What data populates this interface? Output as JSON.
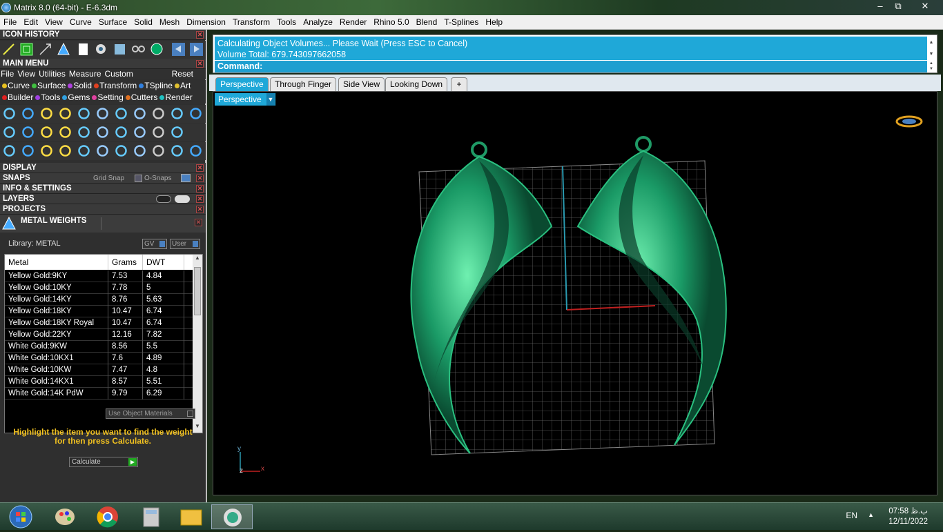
{
  "window": {
    "title": "Matrix 8.0 (64-bit) - E-6.3dm",
    "min": "‒",
    "max": "⧉",
    "close": "✕"
  },
  "menubar": [
    "File",
    "Edit",
    "View",
    "Curve",
    "Surface",
    "Solid",
    "Mesh",
    "Dimension",
    "Transform",
    "Tools",
    "Analyze",
    "Render",
    "Rhino 5.0",
    "Blend",
    "T-Splines",
    "Help"
  ],
  "panels": {
    "icon_history": "ICON HISTORY",
    "main_menu": "MAIN MENU",
    "display": "DISPLAY",
    "snaps": "SNAPS",
    "grid_snap": "Grid Snap",
    "o_snaps": "O-Snaps",
    "info": "INFO & SETTINGS",
    "layers": "LAYERS",
    "projects": "PROJECTS",
    "metal_weights": "METAL WEIGHTS"
  },
  "submenu": {
    "items": [
      "File",
      "View",
      "Utilities",
      "Measure",
      "Custom"
    ],
    "reset": "Reset"
  },
  "categories1": [
    {
      "label": "Curve",
      "color": "#e8c020"
    },
    {
      "label": "Surface",
      "color": "#40c040"
    },
    {
      "label": "Solid",
      "color": "#b040e0"
    },
    {
      "label": "Transform",
      "color": "#e04020"
    },
    {
      "label": "TSpline",
      "color": "#3080e0"
    },
    {
      "label": "Art",
      "color": "#e0c030"
    }
  ],
  "categories2": [
    {
      "label": "Builder",
      "color": "#e02020"
    },
    {
      "label": "Tools",
      "color": "#a040e0"
    },
    {
      "label": "Gems",
      "color": "#30a0e0"
    },
    {
      "label": "Setting",
      "color": "#e040a0"
    },
    {
      "label": "Cutters",
      "color": "#e07020"
    },
    {
      "label": "Render",
      "color": "#20c0c0"
    }
  ],
  "metal": {
    "library": "Library: METAL",
    "gv": "GV",
    "user": "User",
    "headers": [
      "Metal",
      "Grams",
      "DWT"
    ],
    "rows": [
      [
        "Yellow Gold:9KY",
        "7.53",
        "4.84"
      ],
      [
        "Yellow Gold:10KY",
        "7.78",
        "5"
      ],
      [
        "Yellow Gold:14KY",
        "8.76",
        "5.63"
      ],
      [
        "Yellow Gold:18KY",
        "10.47",
        "6.74"
      ],
      [
        "Yellow Gold:18KY Royal",
        "10.47",
        "6.74"
      ],
      [
        "Yellow Gold:22KY",
        "12.16",
        "7.82"
      ],
      [
        "White Gold:9KW",
        "8.56",
        "5.5"
      ],
      [
        "White Gold:10KX1",
        "7.6",
        "4.89"
      ],
      [
        "White Gold:10KW",
        "7.47",
        "4.8"
      ],
      [
        "White Gold:14KX1",
        "8.57",
        "5.51"
      ],
      [
        "White Gold:14K PdW",
        "9.79",
        "6.29"
      ]
    ],
    "use_object_materials": "Use Object Materials",
    "hint": "Highlight the item you want to find the weight for then press Calculate.",
    "calculate": "Calculate"
  },
  "command": {
    "status_line1": "Calculating Object Volumes... Please Wait (Press ESC to Cancel)",
    "status_line2": "Volume Total: 679.743097662058",
    "prompt": "Command:"
  },
  "tabs": [
    "Perspective",
    "Through Finger",
    "Side View",
    "Looking Down"
  ],
  "viewport": {
    "label": "Perspective",
    "axis_y": "y",
    "axis_x": "x",
    "axis_z": "z"
  },
  "taskbar": {
    "lang": "EN",
    "time": "07:58 ب.ظ",
    "date": "12/11/2022"
  },
  "colors": {
    "accent": "#1fa8d8",
    "model": "#1a8a5a"
  }
}
